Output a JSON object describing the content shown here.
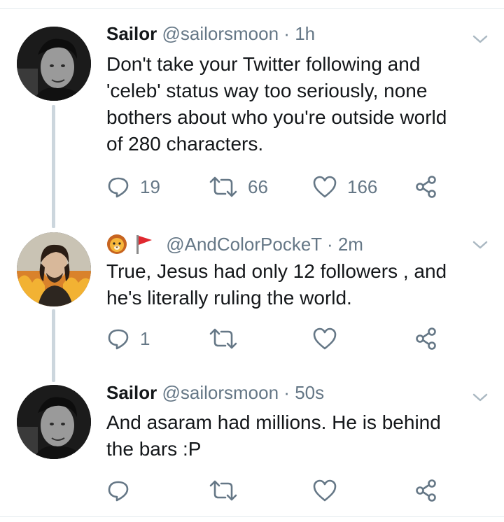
{
  "tweets": [
    {
      "name": "Sailor",
      "handle": "@sailorsmoon",
      "time": "1h",
      "text_lines": [
        "Don't take your Twitter following and",
        "'celeb' status way too seriously, none",
        "bothers about who you're outside world",
        "of 280 characters."
      ],
      "replies": "19",
      "retweets": "66",
      "likes": "166"
    },
    {
      "name": "",
      "name_icons": [
        "lion-face-icon",
        "red-flag-icon"
      ],
      "handle": "@AndColorPockeT",
      "time": "2m",
      "text_lines": [
        "True, Jesus had only 12 followers , and",
        "he's literally ruling the world."
      ],
      "replies": "1",
      "retweets": "",
      "likes": ""
    },
    {
      "name": "Sailor",
      "handle": "@sailorsmoon",
      "time": "50s",
      "text_lines": [
        "And asaram had millions. He is behind",
        "the bars :P"
      ],
      "replies": "",
      "retweets": "",
      "likes": ""
    }
  ],
  "separator": "·",
  "colors": {
    "secondary_text": "#657786",
    "thread_line": "#ccd6dd",
    "flag_red": "#e0282f",
    "lion": "#f4a623"
  }
}
